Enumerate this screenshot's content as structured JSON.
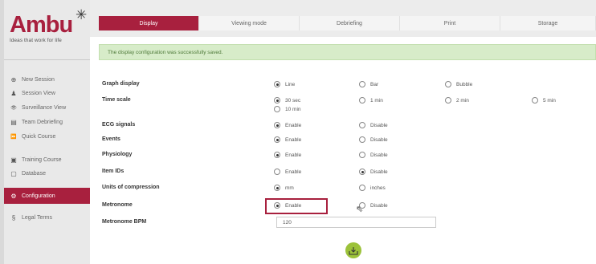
{
  "brand": {
    "logo_word": "Ambu",
    "logo_star": "✳",
    "tagline": "Ideas that work for life",
    "color": "#a8203e"
  },
  "sidebar": {
    "items": [
      {
        "label": "New Session",
        "icon": "plus-circle-icon",
        "glyph": "⊕"
      },
      {
        "label": "Session View",
        "icon": "person-icon",
        "glyph": "♟"
      },
      {
        "label": "Surveillance View",
        "icon": "eye-icon",
        "glyph": "👁"
      },
      {
        "label": "Team Debriefing",
        "icon": "document-icon",
        "glyph": "▤"
      },
      {
        "label": "Quick Course",
        "icon": "fast-forward-icon",
        "glyph": "⏩"
      },
      {
        "label": "Training Course",
        "icon": "square-dot-icon",
        "glyph": "▣"
      },
      {
        "label": "Database",
        "icon": "database-icon",
        "glyph": "▢"
      },
      {
        "label": "Configuration",
        "icon": "wrench-icon",
        "glyph": "⚙"
      },
      {
        "label": "Legal Terms",
        "icon": "section-icon",
        "glyph": "§"
      }
    ]
  },
  "tabs": [
    {
      "label": "Display",
      "active": true
    },
    {
      "label": "Viewing mode",
      "active": false
    },
    {
      "label": "Debriefing",
      "active": false
    },
    {
      "label": "Print",
      "active": false
    },
    {
      "label": "Storage",
      "active": false
    }
  ],
  "alert": {
    "text": "The display configuration was successfully saved."
  },
  "settings": {
    "graph_display": {
      "label": "Graph display",
      "options": [
        {
          "text": "Line",
          "on": true
        },
        {
          "text": "Bar",
          "on": false
        },
        {
          "text": "Bubble",
          "on": false
        }
      ]
    },
    "time_scale": {
      "label": "Time scale",
      "options": [
        {
          "text": "30 sec",
          "on": true
        },
        {
          "text": "1 min",
          "on": false
        },
        {
          "text": "2 min",
          "on": false
        },
        {
          "text": "5 min",
          "on": false
        },
        {
          "text": "10 min",
          "on": false
        }
      ]
    },
    "ecg_signals": {
      "label": "ECG signals",
      "options": [
        {
          "text": "Enable",
          "on": true
        },
        {
          "text": "Disable",
          "on": false
        }
      ]
    },
    "events": {
      "label": "Events",
      "options": [
        {
          "text": "Enable",
          "on": true
        },
        {
          "text": "Disable",
          "on": false
        }
      ]
    },
    "physiology": {
      "label": "Physiology",
      "options": [
        {
          "text": "Enable",
          "on": true
        },
        {
          "text": "Disable",
          "on": false
        }
      ]
    },
    "item_ids": {
      "label": "Item IDs",
      "options": [
        {
          "text": "Enable",
          "on": false
        },
        {
          "text": "Disable",
          "on": true
        }
      ]
    },
    "units_of_compression": {
      "label": "Units of compression",
      "options": [
        {
          "text": "mm",
          "on": true
        },
        {
          "text": "inches",
          "on": false
        }
      ]
    },
    "metronome": {
      "label": "Metronome",
      "options": [
        {
          "text": "Enable",
          "on": true
        },
        {
          "text": "Disable",
          "on": false
        }
      ]
    },
    "metronome_bpm": {
      "label": "Metronome BPM",
      "value": "120"
    }
  },
  "save": {
    "icon": "save-download-icon",
    "color": "#9cc23a"
  }
}
